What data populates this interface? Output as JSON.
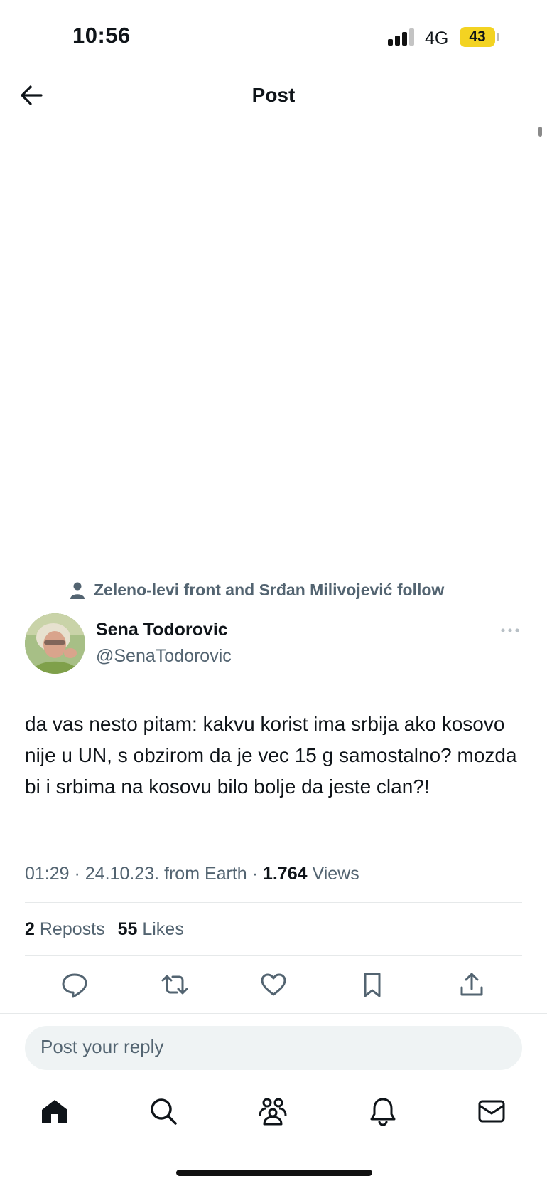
{
  "status_bar": {
    "time": "10:56",
    "network": "4G",
    "battery": "43",
    "battery_color": "#f3d322"
  },
  "header": {
    "title": "Post",
    "back_icon": "arrow-left-icon"
  },
  "social_context": {
    "icon": "person-icon",
    "text": "Zeleno-levi front and Srđan Milivojević follow"
  },
  "author": {
    "name": "Sena Todorovic",
    "handle": "@SenaTodorovic"
  },
  "post": {
    "text": "da vas nesto pitam: kakvu korist ima srbija ako kosovo nije u UN, s obzirom da je vec 15 g samostalno? mozda bi i srbima na kosovu bilo bolje da jeste clan?!",
    "time": "01:29",
    "date": "24.10.23.",
    "source": "from Earth",
    "separator": "·",
    "views_count": "1.764",
    "views_label": "Views"
  },
  "stats": {
    "reposts_count": "2",
    "reposts_label": "Reposts",
    "likes_count": "55",
    "likes_label": "Likes"
  },
  "actions": [
    "reply-icon",
    "repost-icon",
    "like-icon",
    "bookmark-icon",
    "share-icon"
  ],
  "reply": {
    "placeholder": "Post your reply"
  },
  "bottom_nav": [
    "home-icon",
    "search-icon",
    "communities-icon",
    "notifications-icon",
    "messages-icon"
  ],
  "colors": {
    "text_primary": "#0f1419",
    "text_secondary": "#536471",
    "input_bg": "#eff3f4"
  }
}
